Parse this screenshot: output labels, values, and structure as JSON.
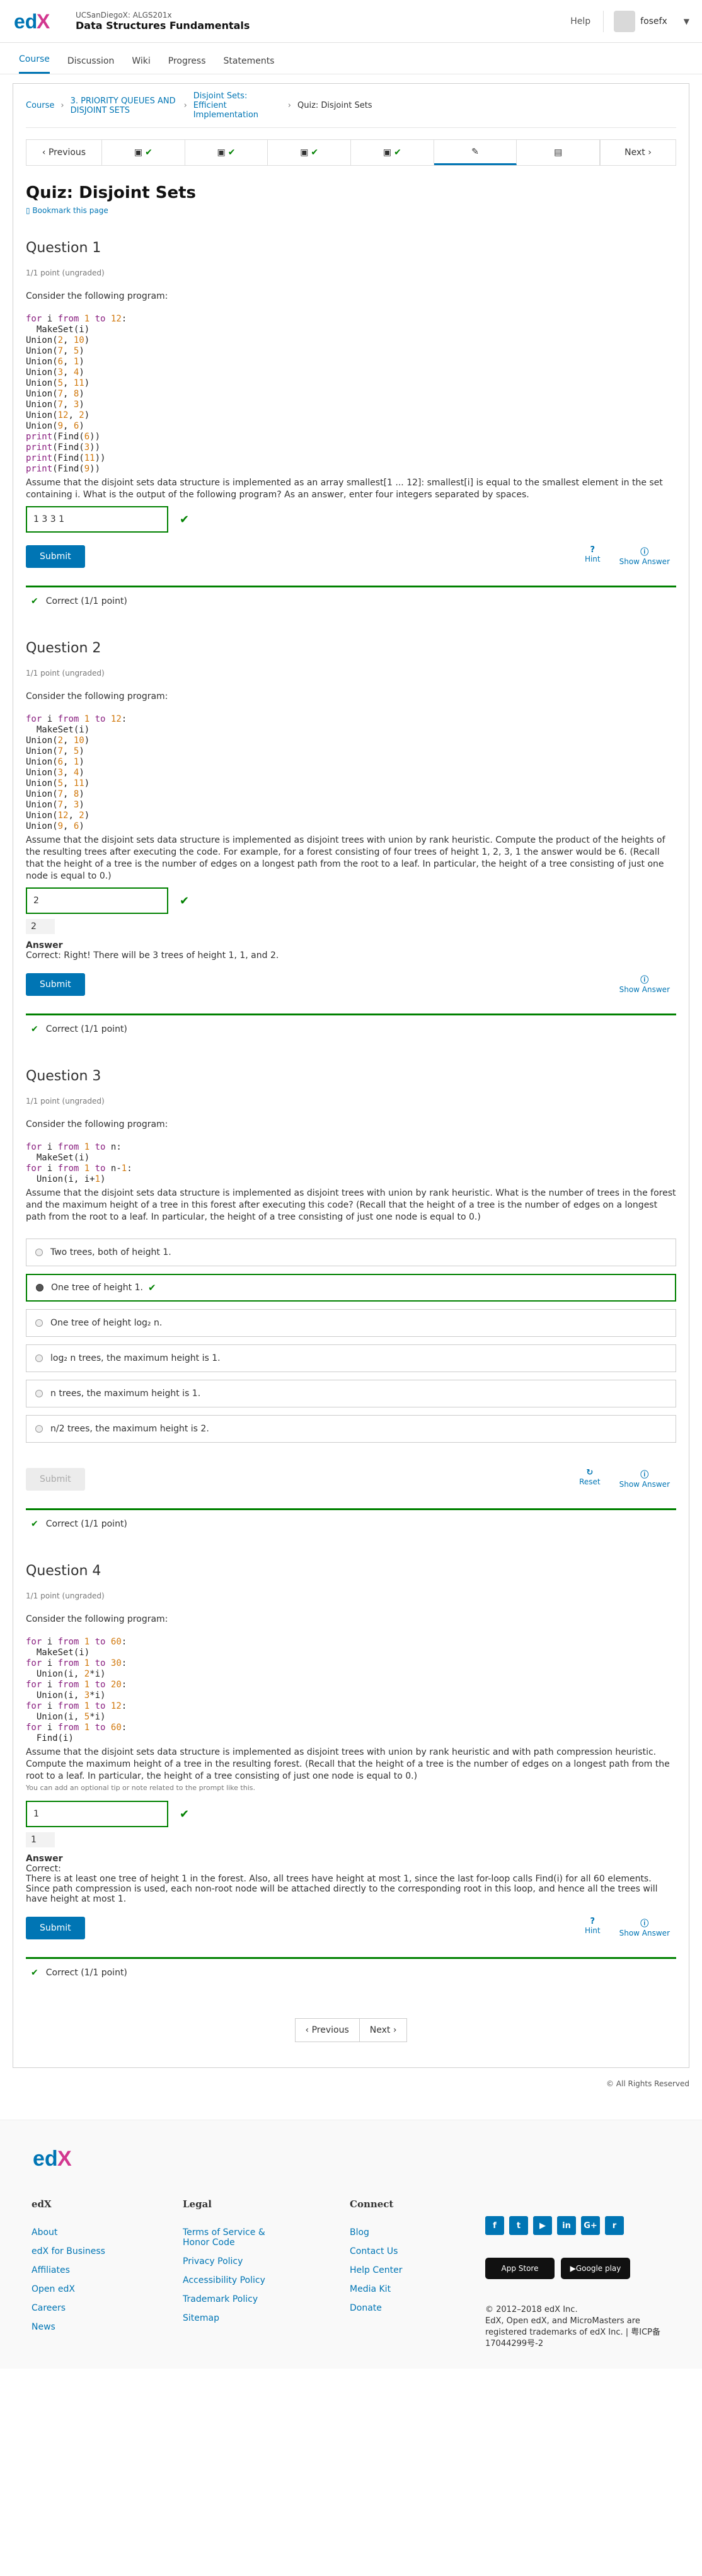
{
  "header": {
    "course_org": "UCSanDiegoX: ALGS201x",
    "course_name": "Data Structures Fundamentals",
    "help": "Help",
    "username": "fosefx"
  },
  "tabs": [
    "Course",
    "Discussion",
    "Wiki",
    "Progress",
    "Statements"
  ],
  "breadcrumbs": {
    "root": "Course",
    "section": "3. PRIORITY QUEUES AND DISJOINT SETS",
    "subsection": "Disjoint Sets: Efficient Implementation",
    "current": "Quiz: Disjoint Sets"
  },
  "seqnav": {
    "previous": "Previous",
    "next": "Next"
  },
  "unit": {
    "title": "Quiz: Disjoint Sets",
    "bookmark": "Bookmark this page"
  },
  "q1": {
    "title": "Question 1",
    "points": "1/1 point (ungraded)",
    "intro": "Consider the following program:",
    "text": "Assume that the disjoint sets data structure is implemented as an array smallest[1 ... 12]: smallest[i] is equal to the smallest element in the set containing i. What is the output of the following program? As an answer, enter four integers separated by spaces.",
    "answer": "1 3 3 1",
    "submit": "Submit",
    "hint": "Hint",
    "show_answer": "Show Answer",
    "result": "Correct (1/1 point)"
  },
  "q2": {
    "title": "Question 2",
    "points": "1/1 point (ungraded)",
    "intro": "Consider the following program:",
    "text": "Assume that the disjoint sets data structure is implemented as disjoint trees with union by rank heuristic. Compute the product of the heights of the resulting trees after executing the code. For example, for a forest consisting of four trees of height 1, 2, 3, 1 the answer would be 6. (Recall that the height of a tree is the number of edges on a longest path from the root to a leaf. In particular, the height of a tree consisting of just one node is equal to 0.)",
    "answer": "2",
    "preview": "2",
    "answer_label": "Answer",
    "explanation": "Correct: Right! There will be 3 trees of height 1, 1, and 2.",
    "submit": "Submit",
    "show_answer": "Show Answer",
    "result": "Correct (1/1 point)"
  },
  "q3": {
    "title": "Question 3",
    "points": "1/1 point (ungraded)",
    "intro": "Consider the following program:",
    "text": "Assume that the disjoint sets data structure is implemented as disjoint trees with union by rank heuristic. What is the number of trees in the forest and the maximum height of a tree in this forest after executing this code? (Recall that the height of a tree is the number of edges on a longest path from the root to a leaf. In particular, the height of a tree consisting of just one node is equal to 0.)",
    "choices": [
      "Two trees, both of height 1.",
      "One tree of height 1.",
      "One tree of height log₂ n.",
      "log₂ n trees, the maximum height is 1.",
      "n trees, the maximum height is 1.",
      "n/2 trees, the maximum height is 2."
    ],
    "submit": "Submit",
    "reset": "Reset",
    "show_answer": "Show Answer",
    "result": "Correct (1/1 point)"
  },
  "q4": {
    "title": "Question 4",
    "points": "1/1 point (ungraded)",
    "intro": "Consider the following program:",
    "text": "Assume that the disjoint sets data structure is implemented as disjoint trees with union by rank heuristic and with path compression heuristic. Compute the maximum height of a tree in the resulting forest. (Recall that the height of a tree is the number of edges on a longest path from the root to a leaf. In particular, the height of a tree consisting of just one node is equal to 0.)",
    "note": "You can add an optional tip or note related to the prompt like this.",
    "answer": "1",
    "preview": "1",
    "answer_label": "Answer",
    "explanation_head": "Correct:",
    "explanation": "There is at least one tree of height 1 in the forest. Also, all trees have height at most 1, since the last for-loop calls Find(i) for all 60 elements. Since path compression is used, each non-root node will be attached directly to the corresponding root in this loop, and hence all the trees will have height at most 1.",
    "submit": "Submit",
    "hint": "Hint",
    "show_answer": "Show Answer",
    "result": "Correct (1/1 point)"
  },
  "bottom_nav": {
    "previous": "Previous",
    "next": "Next"
  },
  "rights": "© All Rights Reserved",
  "footer": {
    "col1_title": "edX",
    "col1": [
      "About",
      "edX for Business",
      "Affiliates",
      "Open edX",
      "Careers",
      "News"
    ],
    "col2_title": "Legal",
    "col2": [
      "Terms of Service & Honor Code",
      "Privacy Policy",
      "Accessibility Policy",
      "Trademark Policy",
      "Sitemap"
    ],
    "col3_title": "Connect",
    "col3": [
      "Blog",
      "Contact Us",
      "Help Center",
      "Media Kit",
      "Donate"
    ],
    "app_store": "App Store",
    "google_play": "Google play",
    "copyright": "© 2012–2018 edX Inc.",
    "trademark": "EdX, Open edX, and MicroMasters are registered trademarks of edX Inc. | 粤ICP备17044299号-2"
  }
}
